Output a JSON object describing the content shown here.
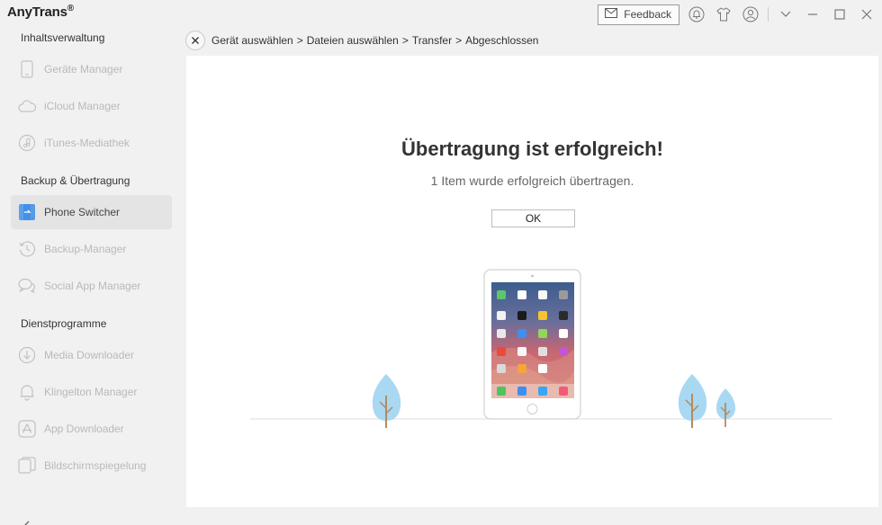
{
  "app": {
    "title": "AnyTrans",
    "registered_mark": "®"
  },
  "titlebar": {
    "feedback_label": "Feedback",
    "icons": [
      "envelope-icon",
      "bell-icon",
      "tshirt-icon",
      "user-icon",
      "chevron-down-icon",
      "minimize-icon",
      "maximize-icon",
      "close-icon"
    ]
  },
  "sidebar": {
    "sections": [
      {
        "title": "Inhaltsverwaltung",
        "items": [
          {
            "label": "Geräte Manager",
            "icon": "phone-icon"
          },
          {
            "label": "iCloud Manager",
            "icon": "cloud-icon"
          },
          {
            "label": "iTunes-Mediathek",
            "icon": "music-note-icon"
          }
        ]
      },
      {
        "title": "Backup & Übertragung",
        "items": [
          {
            "label": "Phone Switcher",
            "icon": "phone-switcher-icon",
            "active": true
          },
          {
            "label": "Backup-Manager",
            "icon": "history-icon"
          },
          {
            "label": "Social App Manager",
            "icon": "chat-bubbles-icon"
          }
        ]
      },
      {
        "title": "Dienstprogramme",
        "items": [
          {
            "label": "Media Downloader",
            "icon": "download-icon"
          },
          {
            "label": "Klingelton Manager",
            "icon": "bell-icon"
          },
          {
            "label": "App Downloader",
            "icon": "app-store-icon"
          },
          {
            "label": "Bildschirmspiegelung",
            "icon": "mirror-screen-icon"
          }
        ]
      }
    ]
  },
  "breadcrumb": {
    "items": [
      "Gerät auswählen",
      "Dateien auswählen",
      "Transfer",
      "Abgeschlossen"
    ],
    "separator": ">"
  },
  "result": {
    "title": "Übertragung ist erfolgreich!",
    "subtitle": "1 Item wurde erfolgreich übertragen.",
    "ok_label": "OK"
  },
  "colors": {
    "accent": "#3e8de6",
    "tree": "#a9d8f2",
    "trunk": "#b58a5e",
    "ipad_screen": "#c85a63"
  }
}
